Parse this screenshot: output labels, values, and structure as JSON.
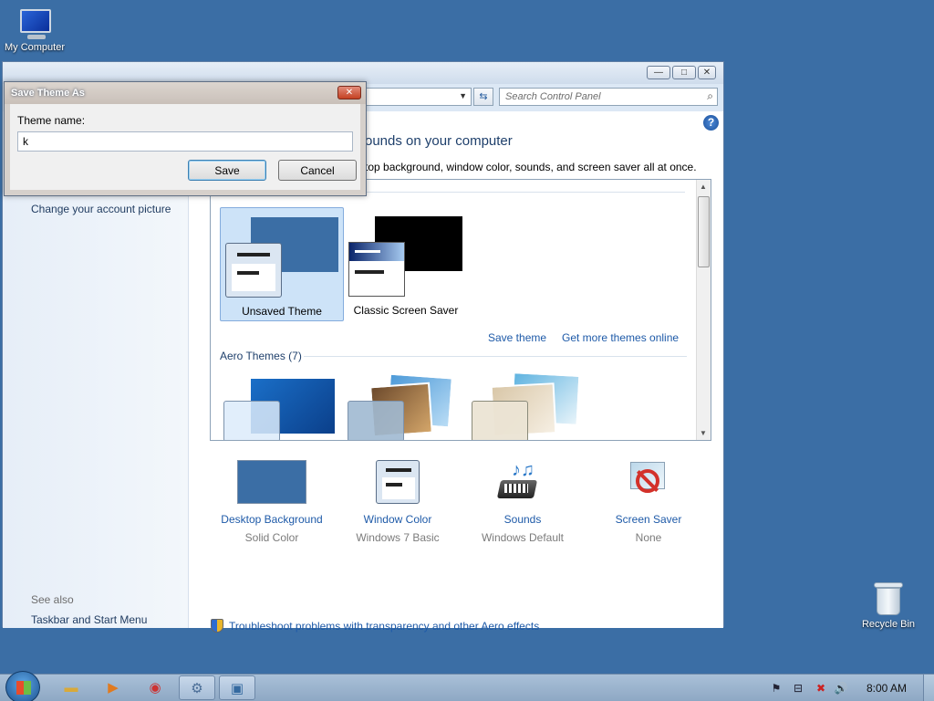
{
  "desktop": {
    "icons": [
      {
        "label": "My Computer",
        "icon": "computer-icon"
      },
      {
        "label": "Recycle Bin",
        "icon": "recycle-bin-icon"
      }
    ]
  },
  "window": {
    "caption_buttons": {
      "minimize": "—",
      "maximize": "□",
      "close": "✕"
    },
    "search": {
      "placeholder": "Search Control Panel"
    },
    "page_title": "ounds on your computer",
    "page_subtitle": "top background, window color, sounds, and screen saver all at once.",
    "left_pane": {
      "links": [
        "Change your account picture"
      ],
      "see_also_label": "See also",
      "see_also_links": [
        "Taskbar and Start Menu"
      ]
    },
    "themes": {
      "my_themes": [
        {
          "label": "Unsaved Theme",
          "selected": true
        },
        {
          "label": "Classic Screen Saver",
          "selected": false
        }
      ],
      "save_theme_link": "Save theme",
      "more_themes_link": "Get more themes online",
      "aero_section_title": "Aero Themes (7)"
    },
    "bottom_items": [
      {
        "title": "Desktop Background",
        "sub": "Solid Color",
        "icon": "desktop-background-icon"
      },
      {
        "title": "Window Color",
        "sub": "Windows 7 Basic",
        "icon": "window-color-icon"
      },
      {
        "title": "Sounds",
        "sub": "Windows Default",
        "icon": "sounds-icon"
      },
      {
        "title": "Screen Saver",
        "sub": "None",
        "icon": "screen-saver-icon"
      }
    ],
    "troubleshoot_link": "Troubleshoot problems with transparency and other Aero effects"
  },
  "dialog": {
    "title": "Save Theme As",
    "close": "✕",
    "label": "Theme name:",
    "value": "k",
    "save_label": "Save",
    "cancel_label": "Cancel"
  },
  "taskbar": {
    "clock": "8:00 AM",
    "pinned": [
      "explorer-icon",
      "media-player-icon",
      "chrome-icon",
      "control-panel-icon",
      "remote-desktop-icon"
    ]
  },
  "colors": {
    "desktop": "#3b6ea5",
    "link": "#1e5aa8",
    "selected_theme": "#cde3f8",
    "solid_color_swatch": "#3b6ea5"
  }
}
